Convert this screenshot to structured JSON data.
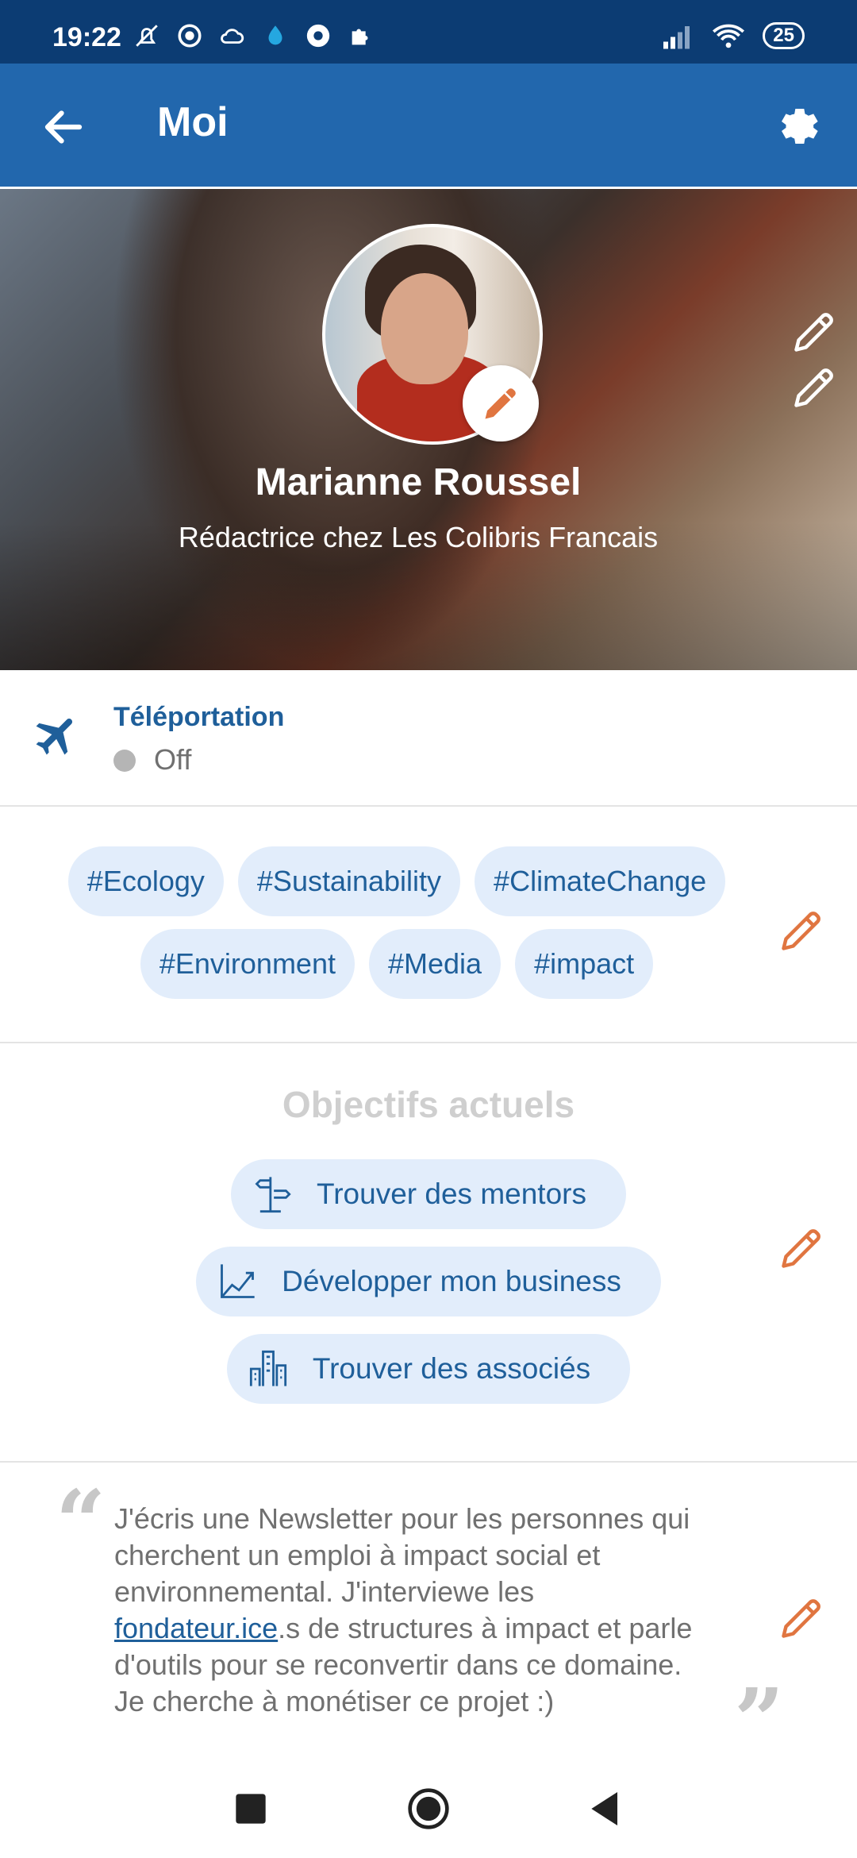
{
  "status_bar": {
    "time": "19:22",
    "battery": "25"
  },
  "app_bar": {
    "title": "Moi"
  },
  "profile": {
    "name": "Marianne Roussel",
    "role": "Rédactrice chez Les Colibris Francais"
  },
  "teleportation": {
    "title": "Téléportation",
    "state": "Off"
  },
  "tags": [
    "#Ecology",
    "#Sustainability",
    "#ClimateChange",
    "#Environment",
    "#Media",
    "#impact"
  ],
  "goals": {
    "title": "Objectifs actuels",
    "items": [
      {
        "label": "Trouver des mentors",
        "icon": "signpost-icon"
      },
      {
        "label": "Développer mon business",
        "icon": "growth-chart-icon"
      },
      {
        "label": "Trouver des associés",
        "icon": "buildings-icon"
      }
    ]
  },
  "bio": {
    "before_link": "J'écris une Newsletter pour les personnes qui cherchent un emploi à impact social et environnemental. J'interviewe les ",
    "link": "fondateur.ice",
    "after_link": ".s de structures à impact et parle d'outils pour se reconvertir dans ce domaine. Je cherche à monétiser ce projet :)"
  },
  "colors": {
    "primary": "#2267ad",
    "status_bar": "#0c3c73",
    "accent_edit": "#e07540",
    "chip_bg": "#e2edfb"
  }
}
